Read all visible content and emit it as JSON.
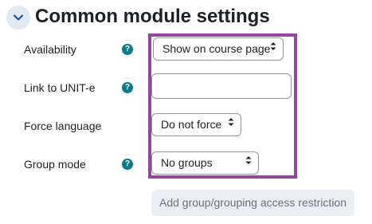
{
  "section": {
    "title": "Common module settings",
    "toggle_icon": "chevron-down-icon"
  },
  "fields": {
    "availability": {
      "label": "Availability",
      "value": "Show on course page",
      "help_icon": "question-icon"
    },
    "link_unite": {
      "label": "Link to UNIT-e",
      "value": "",
      "help_icon": "question-icon"
    },
    "force_language": {
      "label": "Force language",
      "value": "Do not force"
    },
    "group_mode": {
      "label": "Group mode",
      "value": "No groups",
      "help_icon": "question-icon"
    }
  },
  "help_glyph": "?",
  "select_arrows_glyph": "▲▼",
  "buttons": {
    "add_group_restriction": "Add group/grouping access restriction"
  },
  "colors": {
    "highlight_frame": "#93479b",
    "help_icon": "#0d7a8c",
    "toggle_bg": "#e3e9f2",
    "disabled_button_bg": "#ebeef2"
  }
}
